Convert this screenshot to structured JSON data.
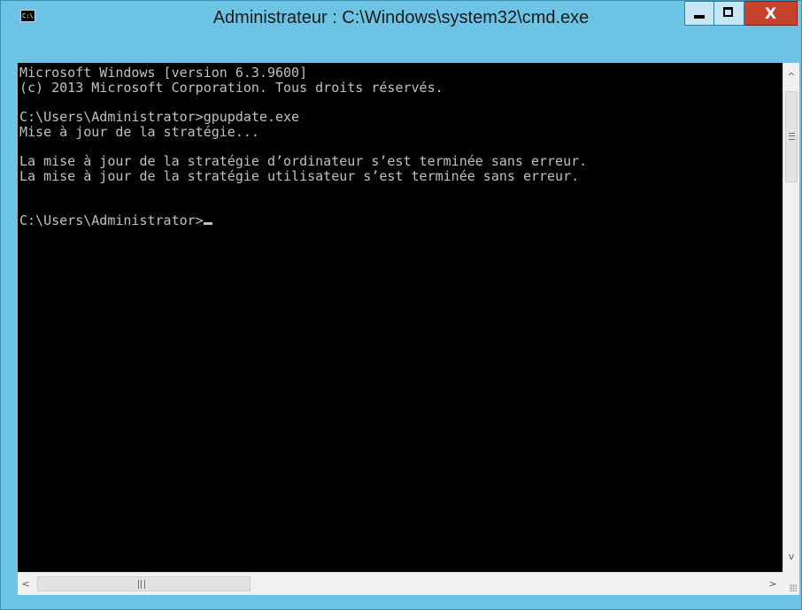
{
  "window": {
    "title": "Administrateur : C:\\Windows\\system32\\cmd.exe",
    "icon_label": "C:\\.",
    "icon_name": "cmd-console-icon",
    "controls": {
      "minimize_icon": "minimize-icon",
      "maximize_icon": "maximize-icon",
      "close_label": "X"
    },
    "colors": {
      "frame": "#6cc3e4",
      "close_button": "#c7432e",
      "console_background": "#000000",
      "console_text": "#c0c0c0"
    }
  },
  "console": {
    "lines": [
      "Microsoft Windows [version 6.3.9600]",
      "(c) 2013 Microsoft Corporation. Tous droits réservés.",
      "",
      "C:\\Users\\Administrator>gpupdate.exe",
      "Mise à jour de la stratégie...",
      "",
      "La mise à jour de la stratégie d’ordinateur s’est terminée sans erreur.",
      "La mise à jour de la stratégie utilisateur s’est terminée sans erreur.",
      "",
      "",
      "C:\\Users\\Administrator>"
    ]
  },
  "scrollbars": {
    "vertical": {
      "up_glyph": "^",
      "down_glyph": "v",
      "grip_icon": "grip-horizontal-icon"
    },
    "horizontal": {
      "left_glyph": "<",
      "right_glyph": ">",
      "grip_icon": "grip-vertical-icon"
    }
  }
}
